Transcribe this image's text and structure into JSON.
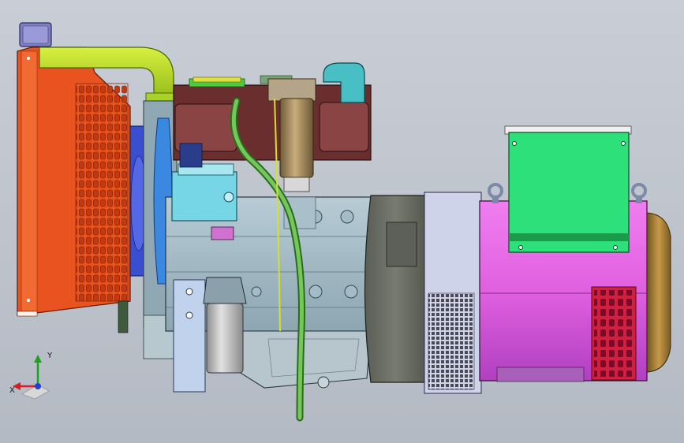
{
  "viewport": {
    "background_top": "#c9ced6",
    "background_bottom": "#b4bac3"
  },
  "model": {
    "radiator_color": "#e8531f",
    "intake_pipe_color": "#b8e020",
    "engine_block_color": "#9fb8c3",
    "cylinder_head_color": "#7a3b3b",
    "fuel_pump_color": "#76d6e6",
    "hose_color": "#5fb04a",
    "alternator_color": "#e878e8",
    "terminal_box_color": "#2ee07a",
    "bell_housing_color": "#666a60",
    "oil_filter_color": "#c8c8c8",
    "fuel_filter_color": "#a89060"
  },
  "triad": {
    "x_label": "X",
    "y_label": "Y",
    "x_color": "#d42020",
    "y_color": "#20a020",
    "z_color": "#2040d0"
  }
}
